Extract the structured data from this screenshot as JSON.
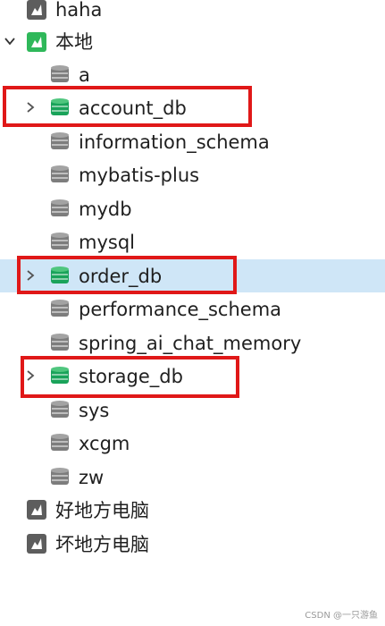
{
  "tree": {
    "connections": [
      {
        "label": "haha",
        "expanded": false
      },
      {
        "label": "本地",
        "expanded": true
      },
      {
        "label": "好地方电脑",
        "expanded": false
      },
      {
        "label": "坏地方电脑",
        "expanded": false
      }
    ],
    "databases": [
      {
        "label": "a",
        "active": false
      },
      {
        "label": "account_db",
        "active": true
      },
      {
        "label": "information_schema",
        "active": false
      },
      {
        "label": "mybatis-plus",
        "active": false
      },
      {
        "label": "mydb",
        "active": false
      },
      {
        "label": "mysql",
        "active": false
      },
      {
        "label": "order_db",
        "active": true,
        "selected": true
      },
      {
        "label": "performance_schema",
        "active": false
      },
      {
        "label": "spring_ai_chat_memory",
        "active": false
      },
      {
        "label": "storage_db",
        "active": true
      },
      {
        "label": "sys",
        "active": false
      },
      {
        "label": "xcgm",
        "active": false
      },
      {
        "label": "zw",
        "active": false
      }
    ]
  },
  "colors": {
    "selected_row": "#cfe6f7",
    "highlight_border": "#e01818",
    "db_active": "#1aa35a",
    "db_inactive": "#7d7d7d",
    "connection_icon": "#5d5d5d",
    "connection_active_icon": "#2fb85a"
  },
  "watermark": "CSDN @一只游鱼"
}
